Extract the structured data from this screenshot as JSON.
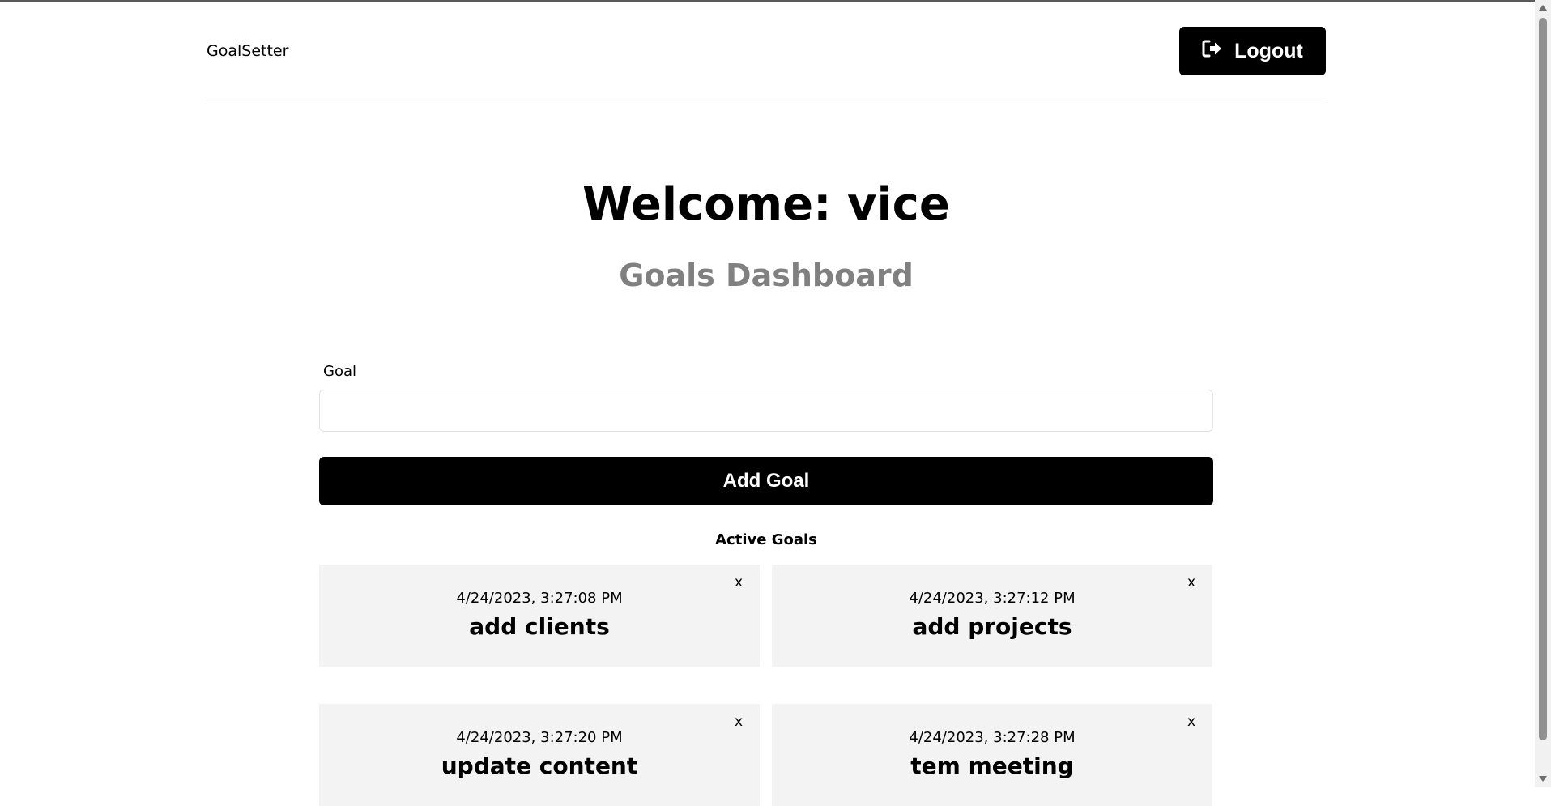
{
  "header": {
    "brand": "GoalSetter",
    "logout_label": "Logout",
    "logout_icon": "sign-out-icon"
  },
  "main": {
    "welcome": "Welcome: vice",
    "subtitle": "Goals Dashboard",
    "goal_label": "Goal",
    "goal_value": "",
    "goal_placeholder": "",
    "add_button": "Add Goal",
    "active_title": "Active Goals"
  },
  "goals": [
    {
      "date": "4/24/2023, 3:27:08 PM",
      "text": "add clients",
      "close": "x"
    },
    {
      "date": "4/24/2023, 3:27:12 PM",
      "text": "add projects",
      "close": "x"
    },
    {
      "date": "4/24/2023, 3:27:20 PM",
      "text": "update content",
      "close": "x"
    },
    {
      "date": "4/24/2023, 3:27:28 PM",
      "text": "tem meeting",
      "close": "x"
    }
  ],
  "colors": {
    "primary": "#000000",
    "card_bg": "#f3f3f3",
    "subtitle": "#808080"
  }
}
